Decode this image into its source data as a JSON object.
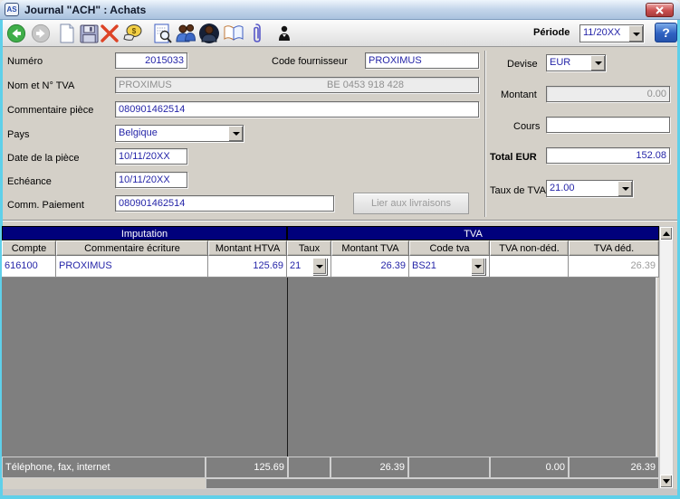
{
  "window": {
    "title": "Journal \"ACH\" : Achats",
    "app_badge": "AS"
  },
  "toolbar": {
    "icons": [
      "back",
      "forward",
      "new-document",
      "save",
      "delete",
      "payment",
      "search-document",
      "users",
      "user",
      "book",
      "attachment",
      "contact"
    ],
    "periode_label": "Période",
    "periode_value": "11/20XX",
    "help_label": "?"
  },
  "form": {
    "numero_label": "Numéro",
    "numero_value": "2015033",
    "code_fournisseur_label": "Code fournisseur",
    "code_fournisseur_value": "PROXIMUS",
    "nom_tva_label": "Nom et N° TVA",
    "nom_tva_name": "PROXIMUS",
    "nom_tva_number": "BE 0453 918 428",
    "commentaire_piece_label": "Commentaire pièce",
    "commentaire_piece_value": "080901462514",
    "pays_label": "Pays",
    "pays_value": "Belgique",
    "date_piece_label": "Date de la pièce",
    "date_piece_value": "10/11/20XX",
    "echeance_label": "Echéance",
    "echeance_value": "10/11/20XX",
    "comm_paiement_label": "Comm. Paiement",
    "comm_paiement_value": "080901462514",
    "lier_livraisons_button": "Lier aux livraisons",
    "devise_label": "Devise",
    "devise_value": "EUR",
    "montant_label": "Montant",
    "montant_value": "0.00",
    "cours_label": "Cours",
    "cours_value": "",
    "total_eur_label": "Total EUR",
    "total_eur_value": "152.08",
    "taux_tva_label": "Taux de TVA",
    "taux_tva_value": "21.00"
  },
  "table": {
    "group_imputation": "Imputation",
    "group_tva": "TVA",
    "columns": {
      "compte": "Compte",
      "commentaire": "Commentaire écriture",
      "montant_htva": "Montant HTVA",
      "taux": "Taux",
      "montant_tva": "Montant TVA",
      "code_tva": "Code tva",
      "tva_non_ded": "TVA non-déd.",
      "tva_ded": "TVA déd."
    },
    "rows": [
      {
        "compte": "616100",
        "commentaire": "PROXIMUS",
        "montant_htva": "125.69",
        "taux": "21",
        "montant_tva": "26.39",
        "code_tva": "BS21",
        "tva_non_ded": "",
        "tva_ded": "26.39"
      }
    ],
    "totals": {
      "label": "Téléphone, fax, internet",
      "montant_htva": "125.69",
      "taux": "",
      "montant_tva": "26.39",
      "code_tva": "",
      "tva_non_ded": "0.00",
      "tva_ded": "26.39"
    }
  },
  "colors": {
    "group_header": "#00007b",
    "input_text": "#2525a8",
    "grid_gray": "#7f7f7f",
    "frame_cyan": "#5fd0ea",
    "titlebar_blue": "#c3d5ea"
  }
}
